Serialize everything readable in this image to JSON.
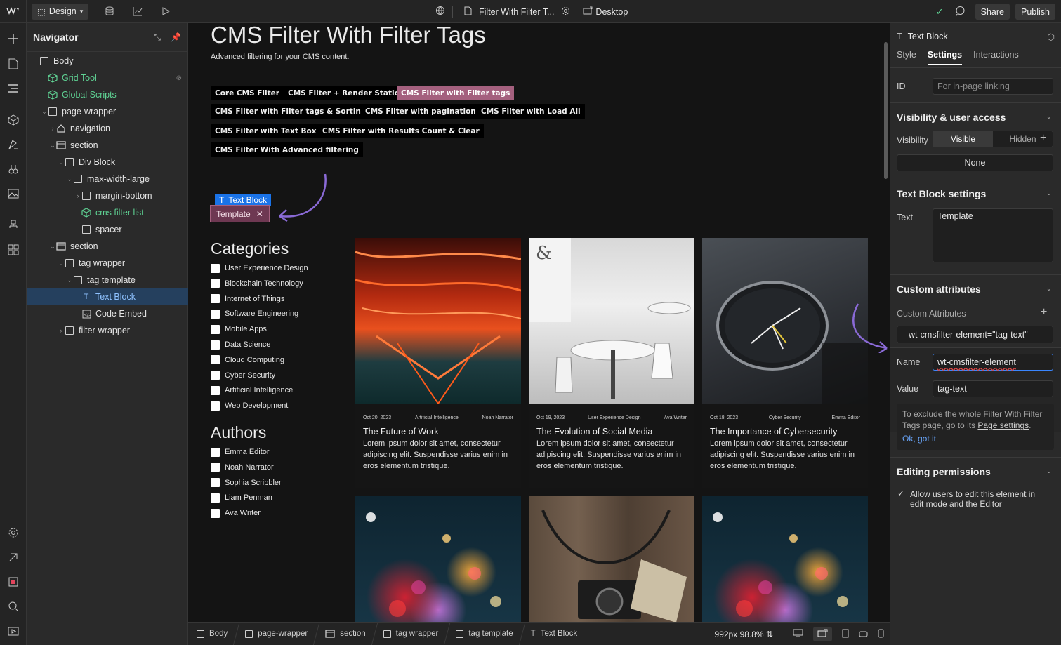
{
  "topbar": {
    "mode_label": "Design",
    "page_name": "Filter With Filter T...",
    "breakpoint_label": "Desktop",
    "share_label": "Share",
    "publish_label": "Publish"
  },
  "navigator": {
    "title": "Navigator",
    "items": [
      {
        "label": "Body",
        "depth": 0,
        "caret": "",
        "icon": "box"
      },
      {
        "label": "Grid Tool",
        "depth": 1,
        "caret": "",
        "icon": "component"
      },
      {
        "label": "Global Scripts",
        "depth": 1,
        "caret": "",
        "icon": "component"
      },
      {
        "label": "page-wrapper",
        "depth": 1,
        "caret": "v",
        "icon": "box"
      },
      {
        "label": "navigation",
        "depth": 2,
        "caret": ">",
        "icon": "home"
      },
      {
        "label": "section",
        "depth": 2,
        "caret": "v",
        "icon": "section"
      },
      {
        "label": "Div Block",
        "depth": 3,
        "caret": "v",
        "icon": "box"
      },
      {
        "label": "max-width-large",
        "depth": 4,
        "caret": "v",
        "icon": "box"
      },
      {
        "label": "margin-bottom",
        "depth": 5,
        "caret": ">",
        "icon": "box"
      },
      {
        "label": "cms filter list",
        "depth": 5,
        "caret": "",
        "icon": "component"
      },
      {
        "label": "spacer",
        "depth": 5,
        "caret": "",
        "icon": "box"
      },
      {
        "label": "section",
        "depth": 2,
        "caret": "v",
        "icon": "section"
      },
      {
        "label": "tag wrapper",
        "depth": 3,
        "caret": "v",
        "icon": "box"
      },
      {
        "label": "tag template",
        "depth": 4,
        "caret": "v",
        "icon": "box"
      },
      {
        "label": "Text Block",
        "depth": 5,
        "caret": "",
        "icon": "text",
        "selected": true
      },
      {
        "label": "Code Embed",
        "depth": 5,
        "caret": "",
        "icon": "code"
      },
      {
        "label": "filter-wrapper",
        "depth": 3,
        "caret": ">",
        "icon": "box"
      }
    ]
  },
  "canvas": {
    "title": "CMS Filter With Filter Tags",
    "subtitle": "Advanced filtering for your CMS content.",
    "pills": [
      "Core CMS Filter",
      "CMS Filter + Render Static",
      "CMS Filter with Filter tags",
      "CMS Filter with Filter tags & Sorting",
      "CMS Filter with pagination",
      "CMS Filter with Load All",
      "CMS Filter with Text Box",
      "CMS Filter with Results Count & Clear",
      "CMS Filter With Advanced filtering"
    ],
    "selected_element_label": "Text Block",
    "tag_template_text": "Template",
    "categories_heading": "Categories",
    "categories": [
      "User Experience Design",
      "Blockchain Technology",
      "Internet of Things",
      "Software Engineering",
      "Mobile Apps",
      "Data Science",
      "Cloud Computing",
      "Cyber Security",
      "Artificial Intelligence",
      "Web Development"
    ],
    "authors_heading": "Authors",
    "authors": [
      "Emma Editor",
      "Noah Narrator",
      "Sophia Scribbler",
      "Liam Penman",
      "Ava Writer"
    ],
    "cards": [
      {
        "date": "Oct 20, 2023",
        "category": "Artificial Intelligence",
        "author": "Noah Narrator",
        "title": "The Future of Work",
        "body": "Lorem ipsum dolor sit amet, consectetur adipiscing elit. Suspendisse varius enim in eros elementum tristique."
      },
      {
        "date": "Oct 19, 2023",
        "category": "User Experience Design",
        "author": "Ava Writer",
        "title": "The Evolution of Social Media",
        "body": "Lorem ipsum dolor sit amet, consectetur adipiscing elit. Suspendisse varius enim in eros elementum tristique."
      },
      {
        "date": "Oct 18, 2023",
        "category": "Cyber Security",
        "author": "Emma Editor",
        "title": "The Importance of Cybersecurity",
        "body": "Lorem ipsum dolor sit amet, consectetur adipiscing elit. Suspendisse varius enim in eros elementum tristique."
      }
    ]
  },
  "breadcrumbs": [
    "Body",
    "page-wrapper",
    "section",
    "tag wrapper",
    "tag template",
    "Text Block"
  ],
  "viewport": {
    "width_label": "992px",
    "zoom_label": "98.8%"
  },
  "right_panel": {
    "element_name": "Text Block",
    "tabs": [
      "Style",
      "Settings",
      "Interactions"
    ],
    "active_tab": "Settings",
    "id_label": "ID",
    "id_placeholder": "For in-page linking",
    "visibility_section": "Visibility & user access",
    "visibility_label": "Visibility",
    "visible_label": "Visible",
    "hidden_label": "Hidden",
    "none_label": "None",
    "text_settings_section": "Text Block settings",
    "text_label": "Text",
    "text_value": "Template",
    "custom_attr_section": "Custom attributes",
    "custom_attr_label": "Custom Attributes",
    "attribute_chip": "wt-cmsfilter-element=\"tag-text\"",
    "name_label": "Name",
    "name_value": "wt-cmsfilter-element",
    "value_label": "Value",
    "value_value": "tag-text",
    "note_text": "To exclude the whole Filter With Filter Tags page, go to its ",
    "note_link": "Page settings",
    "note_end": ".",
    "note_ok": "Ok, got it",
    "editing_section": "Editing permissions",
    "editing_checkbox_label": "Allow users to edit this element in edit mode and the Editor"
  },
  "colors": {
    "accent_blue": "#1a73e8",
    "selection_bg": "#25405e",
    "component_green": "#5fd394",
    "active_pill": "#a4607e",
    "arrow_purple": "#8a6ad6"
  }
}
